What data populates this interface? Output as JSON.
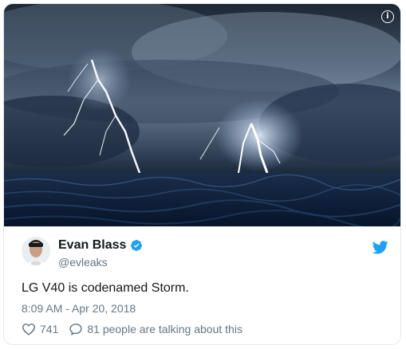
{
  "media": {
    "alt": "Storm over the ocean",
    "info_glyph": "i"
  },
  "author": {
    "name": "Evan Blass",
    "handle": "@evleaks",
    "verified": true
  },
  "tweet": {
    "text": "LG V40 is codenamed Storm.",
    "timestamp": "8:09 AM - Apr 20, 2018",
    "likes": "741",
    "replies_text": "81 people are talking about this"
  },
  "colors": {
    "brand": "#1da1f2",
    "text": "#14171a",
    "muted": "#657786",
    "border": "#e1e8ed"
  },
  "icons": [
    "info-icon",
    "verified-icon",
    "twitter-bird-icon",
    "heart-icon",
    "reply-icon"
  ]
}
